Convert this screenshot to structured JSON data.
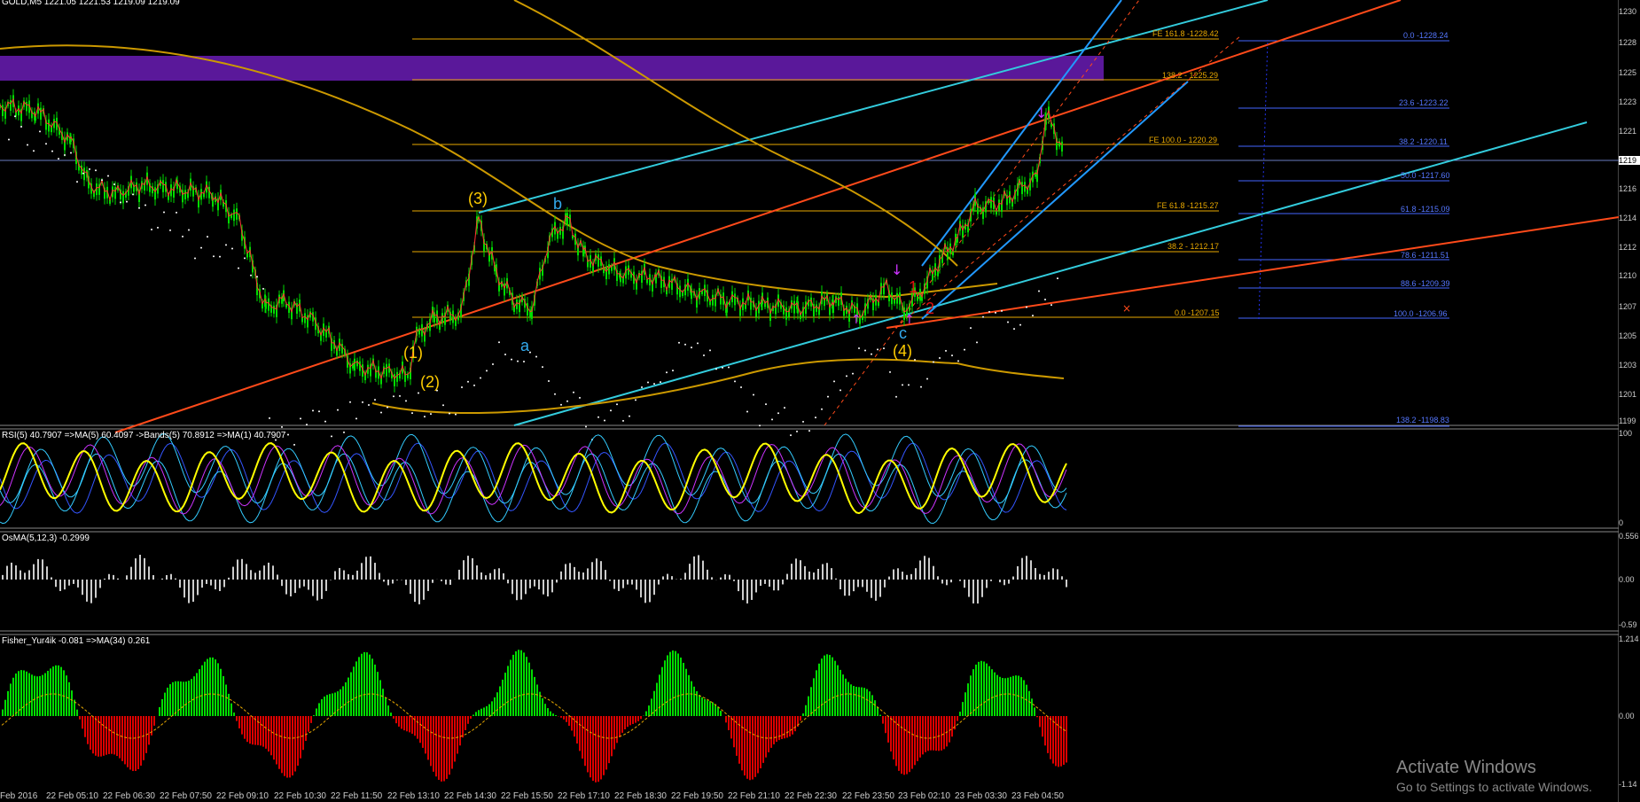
{
  "symbol_header": "GOLD,M5  1221.05 1221.53 1219.09 1219.09",
  "indicators": {
    "rsi_label": "RSI(5) 40.7907  =>MA(5) 60.4097  ->Bands(5) 70.8912  =>MA(1) 40.7907",
    "osma_label": "OsMA(5,12,3) -0.2999",
    "fisher_label": "Fisher_Yur4ik -0.081  =>MA(34) 0.261"
  },
  "price_axis": [
    "1230",
    "1228",
    "1225",
    "1223",
    "1221",
    "1219",
    "1216",
    "1214",
    "1212",
    "1210",
    "1207",
    "1205",
    "1203",
    "1201",
    "1199"
  ],
  "current_price": "1219",
  "rsi_axis": [
    "100",
    "0"
  ],
  "osma_axis": [
    "0.556",
    "0.00",
    "-0.59"
  ],
  "fisher_axis": [
    "1.214",
    "0.00",
    "-1.14"
  ],
  "fib_left": [
    {
      "label": "FE 161.8 -1228.42"
    },
    {
      "label": "138.2 - 1225.29"
    },
    {
      "label": "FE 100.0 - 1220.29"
    },
    {
      "label": "FE 61.8 -1215.27"
    },
    {
      "label": "38.2 - 1212.17"
    },
    {
      "label": "0.0 -1207.15"
    }
  ],
  "fib_right": [
    {
      "label": "0.0 -1228.24"
    },
    {
      "label": "23.6 -1223.22"
    },
    {
      "label": "38.2 -1220.11"
    },
    {
      "label": "50.0 -1217.60"
    },
    {
      "label": "61.8 -1215.09"
    },
    {
      "label": "78.6 -1211.51"
    },
    {
      "label": "88.6 -1209.39"
    },
    {
      "label": "100.0 -1206.96"
    },
    {
      "label": "138.2 -1198.83"
    }
  ],
  "wave_labels": {
    "w1": "(1)",
    "w2": "(2)",
    "w3": "(3)",
    "w4": "(4)",
    "a": "a",
    "b": "b",
    "c": "c",
    "r1": "1",
    "r2": "2"
  },
  "time_axis": [
    "Feb 2016",
    "22 Feb 05:10",
    "22 Feb 06:30",
    "22 Feb 07:50",
    "22 Feb 09:10",
    "22 Feb 10:30",
    "22 Feb 11:50",
    "22 Feb 13:10",
    "22 Feb 14:30",
    "22 Feb 15:50",
    "22 Feb 17:10",
    "22 Feb 18:30",
    "22 Feb 19:50",
    "22 Feb 21:10",
    "22 Feb 22:30",
    "22 Feb 23:50",
    "23 Feb 02:10",
    "23 Feb 03:30",
    "23 Feb 04:50"
  ],
  "watermark": {
    "line1": "Activate Windows",
    "line2": "Go to Settings to activate Windows."
  },
  "colors": {
    "fib": "#e8a800",
    "fib_right": "#4466ff",
    "trend_red": "#ff4a1a",
    "trend_cyan": "#33ccdd",
    "trend_blue": "#2299ff",
    "purple_zone": "#5a189a",
    "price_line": "#00dd00"
  }
}
